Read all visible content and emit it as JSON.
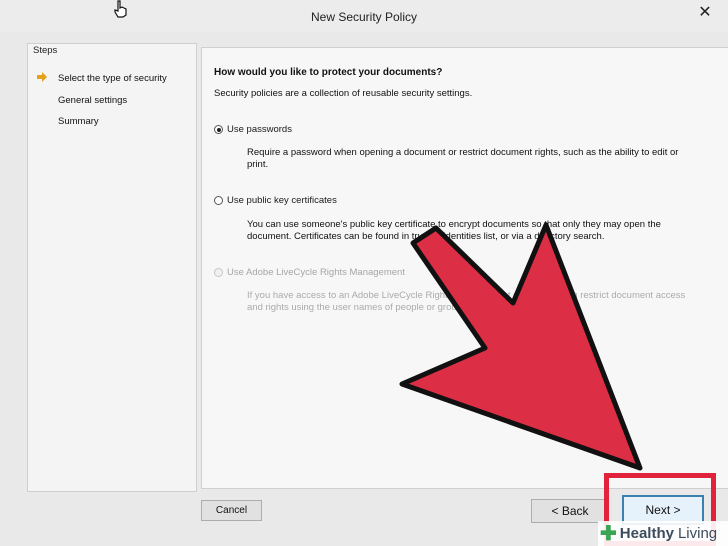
{
  "window": {
    "title": "New Security Policy",
    "close_label": "✕"
  },
  "steps": {
    "heading": "Steps",
    "items": [
      {
        "label": "Select the type of security",
        "current": true
      },
      {
        "label": "General settings",
        "current": false
      },
      {
        "label": "Summary",
        "current": false
      }
    ]
  },
  "main": {
    "question": "How would you like to protect your documents?",
    "description": "Security policies are a collection of reusable security settings.",
    "options": [
      {
        "label": "Use passwords",
        "selected": true,
        "enabled": true,
        "desc_line1": "Require a password when opening a document or restrict document rights, such as the ability to edit or",
        "desc_line2": "print."
      },
      {
        "label": "Use public key certificates",
        "selected": false,
        "enabled": true,
        "desc_line1": "You can use someone's public key certificate to encrypt documents so that only they may open the",
        "desc_line2": "document. Certificates can be found in trusted identities list, or via a directory search."
      },
      {
        "label": "Use Adobe LiveCycle Rights Management",
        "selected": false,
        "enabled": false,
        "desc_line1": "If you have access to an Adobe LiveCycle Rights Management server, you can restrict document access",
        "desc_line2": "and rights using the user names of people or groups."
      }
    ]
  },
  "buttons": {
    "cancel": "Cancel",
    "back": "< Back",
    "next": "Next >"
  },
  "watermark": {
    "brand_bold": "Healthy",
    "brand_light": "Living"
  },
  "colors": {
    "annotation_red": "#e0223a",
    "step_arrow": "#e3a21a",
    "watermark_plus": "#3aa655"
  }
}
